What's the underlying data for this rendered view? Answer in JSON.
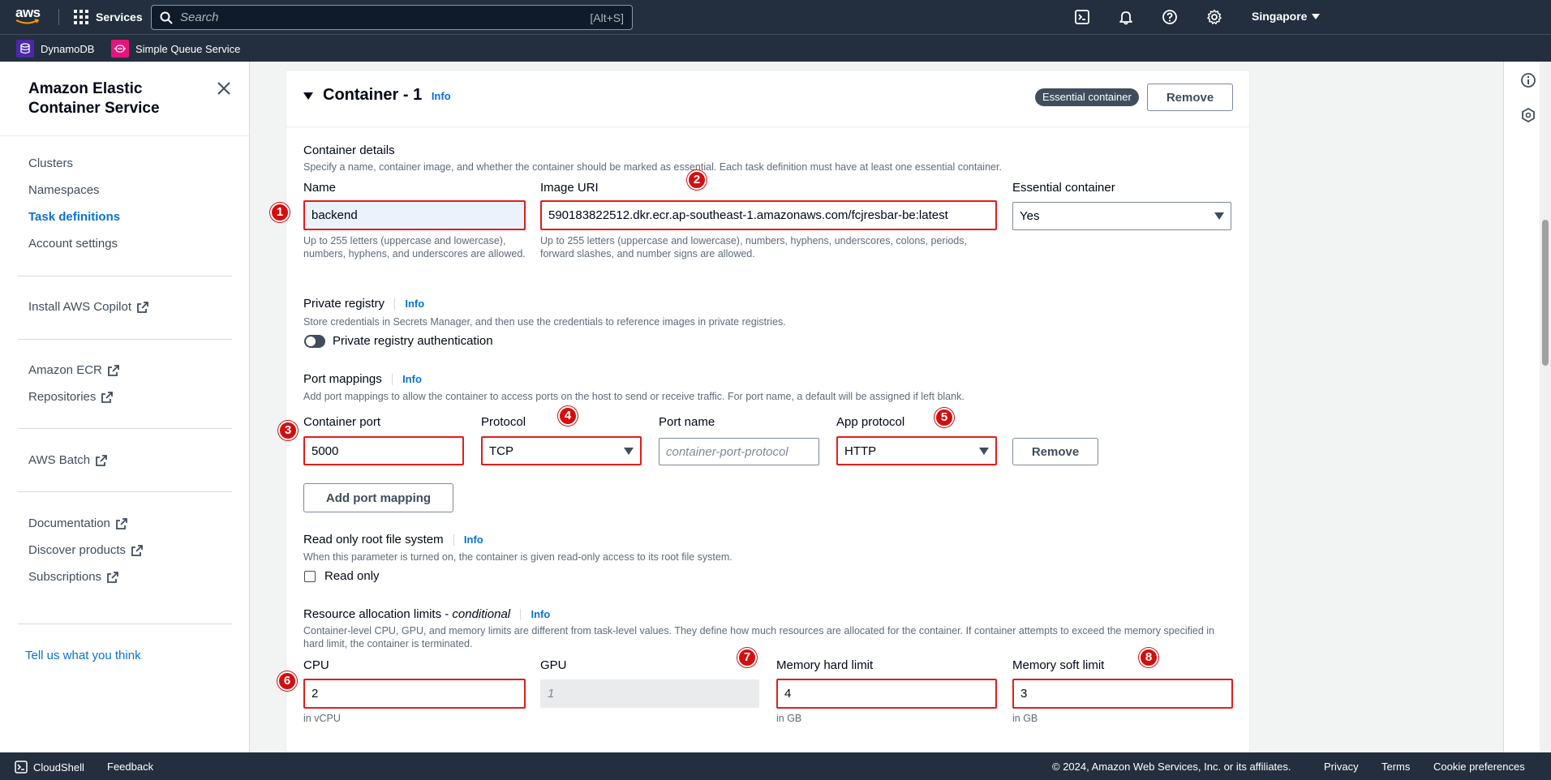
{
  "topnav": {
    "logo_text": "aws",
    "services_label": "Services",
    "search_placeholder": "Search",
    "search_shortcut": "[Alt+S]",
    "region": "Singapore"
  },
  "favorites": [
    {
      "label": "DynamoDB",
      "color": "#4d27aa"
    },
    {
      "label": "Simple Queue Service",
      "color": "#e7157b"
    }
  ],
  "sidebar": {
    "title": "Amazon Elastic Container Service",
    "groups": [
      [
        {
          "label": "Clusters"
        },
        {
          "label": "Namespaces"
        },
        {
          "label": "Task definitions",
          "active": true
        },
        {
          "label": "Account settings"
        }
      ],
      [
        {
          "label": "Install AWS Copilot",
          "external": true
        }
      ],
      [
        {
          "label": "Amazon ECR",
          "external": true
        },
        {
          "label": "Repositories",
          "external": true
        }
      ],
      [
        {
          "label": "AWS Batch",
          "external": true
        }
      ],
      [
        {
          "label": "Documentation",
          "external": true
        },
        {
          "label": "Discover products",
          "external": true
        },
        {
          "label": "Subscriptions",
          "external": true
        }
      ]
    ],
    "feedback": "Tell us what you think"
  },
  "container": {
    "title": "Container - 1",
    "info": "Info",
    "essential_badge": "Essential container",
    "remove_label": "Remove",
    "details": {
      "title": "Container details",
      "desc": "Specify a name, container image, and whether the container should be marked as essential. Each task definition must have at least one essential container.",
      "name_label": "Name",
      "name_value": "backend",
      "name_hint": "Up to 255 letters (uppercase and lowercase), numbers, hyphens, and underscores are allowed.",
      "image_label": "Image URI",
      "image_value": "590183822512.dkr.ecr.ap-southeast-1.amazonaws.com/fcjresbar-be:latest",
      "image_hint": "Up to 255 letters (uppercase and lowercase), numbers, hyphens, underscores, colons, periods, forward slashes, and number signs are allowed.",
      "essential_label": "Essential container",
      "essential_value": "Yes"
    },
    "private_registry": {
      "title": "Private registry",
      "info": "Info",
      "desc": "Store credentials in Secrets Manager, and then use the credentials to reference images in private registries.",
      "toggle_label": "Private registry authentication"
    },
    "port_mappings": {
      "title": "Port mappings",
      "info": "Info",
      "desc": "Add port mappings to allow the container to access ports on the host to send or receive traffic. For port name, a default will be assigned if left blank.",
      "port_label": "Container port",
      "port_value": "5000",
      "protocol_label": "Protocol",
      "protocol_value": "TCP",
      "portname_label": "Port name",
      "portname_placeholder": "container-port-protocol",
      "app_protocol_label": "App protocol",
      "app_protocol_value": "HTTP",
      "remove_label": "Remove",
      "add_label": "Add port mapping"
    },
    "readonly": {
      "title": "Read only root file system",
      "info": "Info",
      "desc": "When this parameter is turned on, the container is given read-only access to its root file system.",
      "checkbox_label": "Read only"
    },
    "resources": {
      "title_main": "Resource allocation limits - ",
      "title_em": "conditional",
      "info": "Info",
      "desc": "Container-level CPU, GPU, and memory limits are different from task-level values. They define how much resources are allocated for the container. If container attempts to exceed the memory specified in hard limit, the container is terminated.",
      "cpu_label": "CPU",
      "cpu_value": "2",
      "cpu_unit": "in vCPU",
      "gpu_label": "GPU",
      "gpu_placeholder": "1",
      "mem_hard_label": "Memory hard limit",
      "mem_hard_value": "4",
      "mem_hard_unit": "in GB",
      "mem_soft_label": "Memory soft limit",
      "mem_soft_value": "3",
      "mem_soft_unit": "in GB"
    }
  },
  "annotations": [
    "1",
    "2",
    "3",
    "4",
    "5",
    "6",
    "7",
    "8"
  ],
  "footer": {
    "cloudshell": "CloudShell",
    "feedback": "Feedback",
    "copyright": "© 2024, Amazon Web Services, Inc. or its affiliates.",
    "privacy": "Privacy",
    "terms": "Terms",
    "cookies": "Cookie preferences"
  },
  "icons": {
    "cloudshell": "terminal-icon",
    "notifications": "bell-icon",
    "help": "help-icon",
    "settings": "gear-icon",
    "close": "close-icon",
    "external": "external-link-icon",
    "info_panel": "info-icon",
    "rail_2": "hexagon-icon"
  },
  "colors": {
    "nav_bg": "#232f3e",
    "link": "#0972d3",
    "highlight": "#e31c1c",
    "badge": "#d20f0f"
  }
}
